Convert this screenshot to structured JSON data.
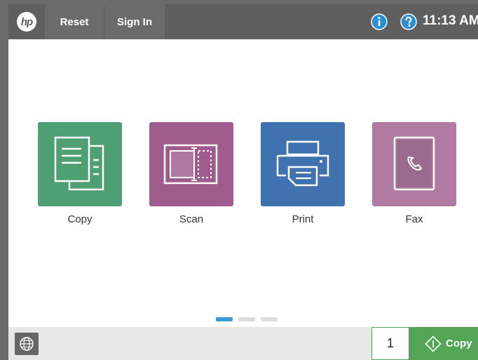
{
  "topbar": {
    "logo_text": "hp",
    "reset_label": "Reset",
    "signin_label": "Sign In",
    "time": "11:13 AM",
    "icons": [
      "hp-logo-icon",
      "info-icon",
      "help-icon"
    ]
  },
  "apps": [
    {
      "label": "Copy",
      "color": "#4f9f74",
      "icon": "copy-icon"
    },
    {
      "label": "Scan",
      "color": "#9e5b8b",
      "icon": "scan-icon"
    },
    {
      "label": "Print",
      "color": "#3f72ae",
      "icon": "print-icon"
    },
    {
      "label": "Fax",
      "color": "#b07aa3",
      "icon": "fax-icon"
    }
  ],
  "pager": {
    "pages": 3,
    "active": 1,
    "active_color": "#3a9ad9"
  },
  "bottombar": {
    "language_icon": "globe-icon",
    "quantity": "1",
    "start_label": "Copy",
    "start_color": "#55a557"
  }
}
